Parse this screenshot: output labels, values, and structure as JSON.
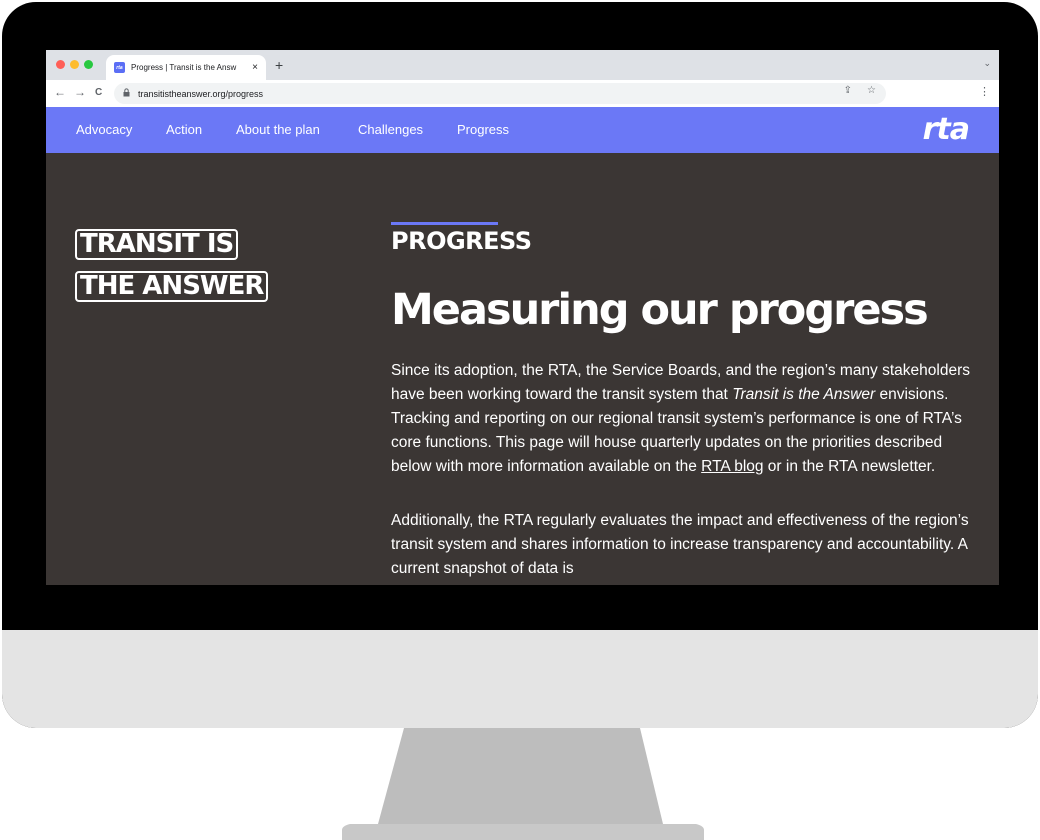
{
  "browser": {
    "tab_title": "Progress | Transit is the Answ",
    "tab_close": "×",
    "new_tab": "+",
    "tab_menu": "⌄",
    "favicon_text": "rta",
    "url": "transitistheanswer.org/progress",
    "back": "←",
    "forward": "→",
    "reload": "C",
    "lock": "🔒",
    "share": "⇪",
    "bookmark": "☆",
    "menu": "⋮"
  },
  "site_nav": {
    "items": [
      "Advocacy",
      "Action",
      "About the plan",
      "Challenges",
      "Progress"
    ],
    "logo": "rta"
  },
  "page": {
    "badge_line1": "TRANSIT IS",
    "badge_line2": "THE ANSWER",
    "section_label": "PROGRESS",
    "title": "Measuring our progress",
    "para1_a": "Since its adoption, the RTA, the Service Boards, and the region’s many stakeholders have been working toward the transit system that ",
    "para1_em": "Transit is the Answer",
    "para1_b": " envisions. Tracking and reporting on our regional transit system’s performance is one of RTA’s core functions. This page will house quarterly updates on the priorities described below with more information available on the ",
    "para1_link": "RTA blog",
    "para1_c": " or in the RTA newsletter.",
    "para2": "Additionally, the RTA regularly evaluates the impact and effectiveness of the region’s transit system and shares information to increase transparency and accountability. A current snapshot of data is"
  },
  "colors": {
    "nav_bg": "#6b78f6",
    "page_bg": "#3b3634",
    "accent": "#6b78f6"
  }
}
